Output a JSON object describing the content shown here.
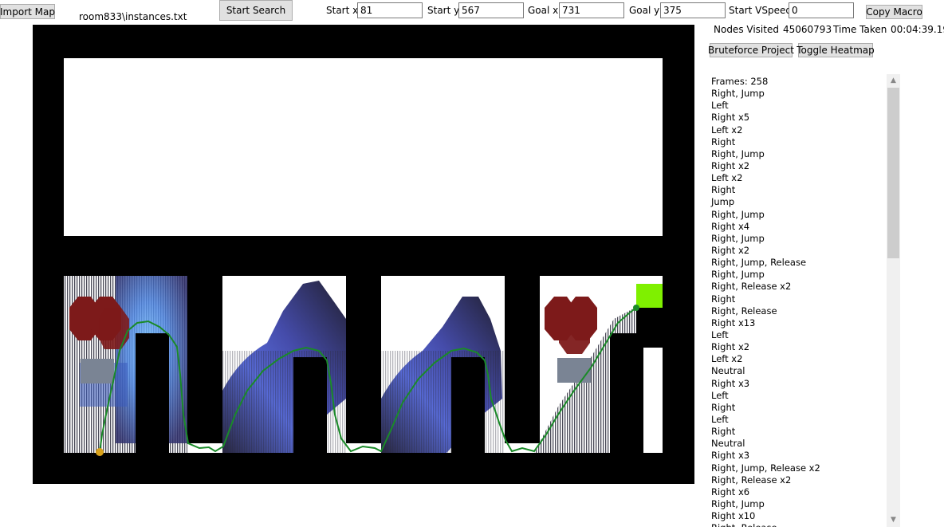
{
  "toolbar": {
    "import_map_label": "Import Map",
    "map_file": "room833\\instances.txt",
    "start_search_label": "Start Search",
    "start_x_label": "Start x",
    "start_x_value": "81",
    "start_y_label": "Start y",
    "start_y_value": "567",
    "goal_x_label": "Goal x",
    "goal_x_value": "731",
    "goal_y_label": "Goal y",
    "goal_y_value": "375",
    "start_vspeed_label": "Start VSpeed",
    "start_vspeed_value": "0",
    "copy_macro_label": "Copy Macro"
  },
  "stats": {
    "nodes_visited_label": "Nodes Visited",
    "nodes_visited_value": "45060793",
    "time_taken_label": "Time Taken",
    "time_taken_value": "00:04:39.19"
  },
  "actions": {
    "bruteforce_label": "Bruteforce Project",
    "heatmap_label": "Toggle Heatmap"
  },
  "colors": {
    "wall": "#000000",
    "spike": "#7d1a1a",
    "path": "#1a8a28",
    "start_marker": "#d9a21b",
    "goal_marker": "#7ff000",
    "block": "#7a8494"
  },
  "macro_list": [
    "Frames: 258",
    "Right, Jump",
    "Left",
    "Right x5",
    "Left x2",
    "Right",
    "Right, Jump",
    "Right x2",
    "Left x2",
    "Right",
    "Jump",
    "Right, Jump",
    "Right x4",
    "Right, Jump",
    "Right x2",
    "Right, Jump, Release",
    "Right, Jump",
    "Right, Release x2",
    "Right",
    "Right, Release",
    "Right x13",
    "Left",
    "Right x2",
    "Left x2",
    "Neutral",
    "Right x3",
    "Left",
    "Right",
    "Left",
    "Right",
    "Neutral",
    "Right x3",
    "Right, Jump, Release x2",
    "Right, Release x2",
    "Right x6",
    "Right, Jump",
    "Right x10",
    "Right, Release"
  ]
}
